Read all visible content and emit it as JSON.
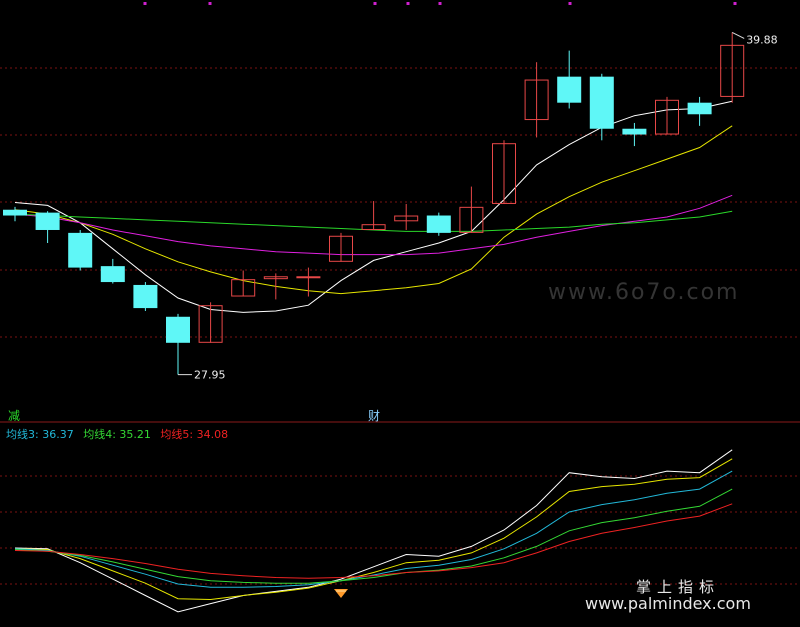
{
  "colors": {
    "background": "#000000",
    "grid": "#7a1212",
    "up": "#e84848",
    "down": "#5ff7f7",
    "ma_short": "#ffffff",
    "ma_mid": "#e6e600",
    "ma_long": "#e020e0",
    "ma_longest": "#2ad82a"
  },
  "chart_data": [
    {
      "type": "candlestick",
      "ylim": [
        27,
        41
      ],
      "price_labels": {
        "high": "39.88",
        "low": "27.95"
      },
      "markers": {
        "left": "减",
        "mid": "财"
      },
      "candles": [
        {
          "o": 33.75,
          "c": 33.55,
          "h": 33.85,
          "l": 33.35
        },
        {
          "o": 33.65,
          "c": 33.05,
          "h": 33.7,
          "l": 32.6
        },
        {
          "o": 32.95,
          "c": 31.75,
          "h": 33.05,
          "l": 31.65
        },
        {
          "o": 31.8,
          "c": 31.25,
          "h": 32.05,
          "l": 31.2
        },
        {
          "o": 31.15,
          "c": 30.35,
          "h": 31.25,
          "l": 30.25
        },
        {
          "o": 30.05,
          "c": 29.15,
          "h": 30.15,
          "l": 28.05
        },
        {
          "o": 29.15,
          "c": 30.45,
          "h": 30.55,
          "l": 29.15
        },
        {
          "o": 30.75,
          "c": 31.35,
          "h": 31.65,
          "l": 30.75
        },
        {
          "o": 31.35,
          "c": 31.45,
          "h": 31.55,
          "l": 30.65
        },
        {
          "o": 31.45,
          "c": 31.45,
          "h": 31.75,
          "l": 30.75
        },
        {
          "o": 31.95,
          "c": 32.85,
          "h": 32.95,
          "l": 31.95
        },
        {
          "o": 33.05,
          "c": 33.25,
          "h": 34.05,
          "l": 33.05
        },
        {
          "o": 33.35,
          "c": 33.55,
          "h": 33.95,
          "l": 33.05
        },
        {
          "o": 33.55,
          "c": 32.95,
          "h": 33.65,
          "l": 32.85
        },
        {
          "o": 32.95,
          "c": 33.85,
          "h": 34.55,
          "l": 32.95
        },
        {
          "o": 33.95,
          "c": 36.05,
          "h": 36.15,
          "l": 33.95
        },
        {
          "o": 36.85,
          "c": 38.25,
          "h": 38.85,
          "l": 36.25
        },
        {
          "o": 38.35,
          "c": 37.45,
          "h": 39.25,
          "l": 37.25
        },
        {
          "o": 38.35,
          "c": 36.55,
          "h": 38.45,
          "l": 36.15
        },
        {
          "o": 36.55,
          "c": 36.35,
          "h": 36.75,
          "l": 35.95
        },
        {
          "o": 36.35,
          "c": 37.55,
          "h": 37.65,
          "l": 36.35
        },
        {
          "o": 37.45,
          "c": 37.05,
          "h": 37.65,
          "l": 36.65
        },
        {
          "o": 37.65,
          "c": 39.45,
          "h": 39.88,
          "l": 37.45
        }
      ],
      "ma_lines": [
        {
          "key": "ma_short",
          "values": [
            [
              0,
              34.0
            ],
            [
              1,
              33.9
            ],
            [
              2,
              33.3
            ],
            [
              3,
              32.4
            ],
            [
              4,
              31.5
            ],
            [
              5,
              30.7
            ],
            [
              6,
              30.3
            ],
            [
              7,
              30.2
            ],
            [
              8,
              30.25
            ],
            [
              9,
              30.45
            ],
            [
              10,
              31.3
            ],
            [
              11,
              32.0
            ],
            [
              12,
              32.3
            ],
            [
              13,
              32.6
            ],
            [
              14,
              33.0
            ],
            [
              15,
              34.1
            ],
            [
              16,
              35.3
            ],
            [
              17,
              36.0
            ],
            [
              18,
              36.6
            ],
            [
              19,
              37.0
            ],
            [
              20,
              37.2
            ],
            [
              21,
              37.25
            ],
            [
              22,
              37.5
            ]
          ]
        },
        {
          "key": "ma_mid",
          "values": [
            [
              0,
              33.75
            ],
            [
              1,
              33.6
            ],
            [
              2,
              33.3
            ],
            [
              3,
              32.9
            ],
            [
              4,
              32.4
            ],
            [
              5,
              31.95
            ],
            [
              6,
              31.6
            ],
            [
              7,
              31.3
            ],
            [
              8,
              31.1
            ],
            [
              9,
              30.95
            ],
            [
              10,
              30.85
            ],
            [
              11,
              30.95
            ],
            [
              12,
              31.05
            ],
            [
              13,
              31.2
            ],
            [
              14,
              31.7
            ],
            [
              15,
              32.8
            ],
            [
              16,
              33.6
            ],
            [
              17,
              34.2
            ],
            [
              18,
              34.7
            ],
            [
              19,
              35.1
            ],
            [
              20,
              35.5
            ],
            [
              21,
              35.9
            ],
            [
              22,
              36.65
            ]
          ]
        },
        {
          "key": "ma_long",
          "values": [
            [
              0,
              33.6
            ],
            [
              1,
              33.5
            ],
            [
              2,
              33.3
            ],
            [
              3,
              33.05
            ],
            [
              4,
              32.85
            ],
            [
              5,
              32.65
            ],
            [
              6,
              32.5
            ],
            [
              7,
              32.4
            ],
            [
              8,
              32.3
            ],
            [
              9,
              32.25
            ],
            [
              10,
              32.2
            ],
            [
              11,
              32.2
            ],
            [
              12,
              32.2
            ],
            [
              13,
              32.25
            ],
            [
              14,
              32.4
            ],
            [
              15,
              32.55
            ],
            [
              16,
              32.8
            ],
            [
              17,
              33.0
            ],
            [
              18,
              33.2
            ],
            [
              19,
              33.35
            ],
            [
              20,
              33.5
            ],
            [
              21,
              33.8
            ],
            [
              22,
              34.25
            ]
          ]
        },
        {
          "key": "ma_longest",
          "values": [
            [
              0,
              33.6
            ],
            [
              1,
              33.55
            ],
            [
              2,
              33.5
            ],
            [
              3,
              33.45
            ],
            [
              4,
              33.4
            ],
            [
              5,
              33.35
            ],
            [
              6,
              33.3
            ],
            [
              7,
              33.25
            ],
            [
              8,
              33.2
            ],
            [
              9,
              33.15
            ],
            [
              10,
              33.1
            ],
            [
              11,
              33.05
            ],
            [
              12,
              33.0
            ],
            [
              13,
              33.0
            ],
            [
              14,
              33.0
            ],
            [
              15,
              33.05
            ],
            [
              16,
              33.1
            ],
            [
              17,
              33.15
            ],
            [
              18,
              33.25
            ],
            [
              19,
              33.3
            ],
            [
              20,
              33.4
            ],
            [
              21,
              33.5
            ],
            [
              22,
              33.7
            ]
          ]
        }
      ]
    },
    {
      "type": "line",
      "ylim": [
        25,
        47
      ],
      "legend": [
        {
          "label": "均线3: 36.37",
          "color": "#22b8d8"
        },
        {
          "label": "均线4: 35.21",
          "color": "#34d834"
        },
        {
          "label": "均线5: 34.08",
          "color": "#ee2222"
        }
      ],
      "series": [
        {
          "color": "#ffffff",
          "values": [
            [
              0,
              33.8
            ],
            [
              1,
              33.7
            ],
            [
              2,
              32.0
            ],
            [
              3,
              30.0
            ],
            [
              4,
              28.0
            ],
            [
              5,
              26.0
            ],
            [
              6,
              27.0
            ],
            [
              7,
              28.0
            ],
            [
              8,
              28.5
            ],
            [
              9,
              29.0
            ],
            [
              10,
              30.0
            ],
            [
              11,
              31.5
            ],
            [
              12,
              33.0
            ],
            [
              13,
              32.8
            ],
            [
              14,
              34.0
            ],
            [
              15,
              36.0
            ],
            [
              16,
              39.0
            ],
            [
              17,
              43.0
            ],
            [
              18,
              42.5
            ],
            [
              19,
              42.3
            ],
            [
              20,
              43.2
            ],
            [
              21,
              43.0
            ],
            [
              22,
              45.8
            ]
          ]
        },
        {
          "color": "#e6e600",
          "values": [
            [
              0,
              33.7
            ],
            [
              1,
              33.6
            ],
            [
              2,
              32.5
            ],
            [
              3,
              31.0
            ],
            [
              4,
              29.5
            ],
            [
              5,
              27.6
            ],
            [
              6,
              27.5
            ],
            [
              7,
              28.0
            ],
            [
              8,
              28.4
            ],
            [
              9,
              28.9
            ],
            [
              10,
              29.8
            ],
            [
              11,
              30.8
            ],
            [
              12,
              32.0
            ],
            [
              13,
              32.3
            ],
            [
              14,
              33.2
            ],
            [
              15,
              35.0
            ],
            [
              16,
              37.6
            ],
            [
              17,
              40.7
            ],
            [
              18,
              41.3
            ],
            [
              19,
              41.6
            ],
            [
              20,
              42.2
            ],
            [
              21,
              42.4
            ],
            [
              22,
              44.7
            ]
          ]
        },
        {
          "color": "#22b8d8",
          "values": [
            [
              0,
              33.7
            ],
            [
              1,
              33.5
            ],
            [
              2,
              32.8
            ],
            [
              3,
              31.7
            ],
            [
              4,
              30.6
            ],
            [
              5,
              29.4
            ],
            [
              6,
              29.0
            ],
            [
              7,
              29.0
            ],
            [
              8,
              29.1
            ],
            [
              9,
              29.3
            ],
            [
              10,
              29.8
            ],
            [
              11,
              30.5
            ],
            [
              12,
              31.3
            ],
            [
              13,
              31.7
            ],
            [
              14,
              32.4
            ],
            [
              15,
              33.7
            ],
            [
              16,
              35.6
            ],
            [
              17,
              38.2
            ],
            [
              18,
              39.1
            ],
            [
              19,
              39.7
            ],
            [
              20,
              40.5
            ],
            [
              21,
              41.0
            ],
            [
              22,
              43.2
            ]
          ]
        },
        {
          "color": "#34d834",
          "values": [
            [
              0,
              33.6
            ],
            [
              1,
              33.4
            ],
            [
              2,
              32.9
            ],
            [
              3,
              32.1
            ],
            [
              4,
              31.2
            ],
            [
              5,
              30.3
            ],
            [
              6,
              29.8
            ],
            [
              7,
              29.6
            ],
            [
              8,
              29.5
            ],
            [
              9,
              29.5
            ],
            [
              10,
              29.8
            ],
            [
              11,
              30.2
            ],
            [
              12,
              30.8
            ],
            [
              13,
              31.1
            ],
            [
              14,
              31.6
            ],
            [
              15,
              32.6
            ],
            [
              16,
              34.0
            ],
            [
              17,
              35.9
            ],
            [
              18,
              36.9
            ],
            [
              19,
              37.5
            ],
            [
              20,
              38.3
            ],
            [
              21,
              38.9
            ],
            [
              22,
              41.0
            ]
          ]
        },
        {
          "color": "#ee2222",
          "values": [
            [
              0,
              33.5
            ],
            [
              1,
              33.4
            ],
            [
              2,
              33.0
            ],
            [
              3,
              32.5
            ],
            [
              4,
              31.9
            ],
            [
              5,
              31.2
            ],
            [
              6,
              30.7
            ],
            [
              7,
              30.4
            ],
            [
              8,
              30.2
            ],
            [
              9,
              30.1
            ],
            [
              10,
              30.2
            ],
            [
              11,
              30.4
            ],
            [
              12,
              30.8
            ],
            [
              13,
              31.0
            ],
            [
              14,
              31.4
            ],
            [
              15,
              32.0
            ],
            [
              16,
              33.2
            ],
            [
              17,
              34.6
            ],
            [
              18,
              35.6
            ],
            [
              19,
              36.3
            ],
            [
              20,
              37.1
            ],
            [
              21,
              37.7
            ],
            [
              22,
              39.2
            ]
          ]
        }
      ]
    }
  ],
  "watermarks": {
    "site_faded": "www.6o7o.com",
    "brand_cn": "掌上指标",
    "brand_url": "www.palmindex.com"
  }
}
